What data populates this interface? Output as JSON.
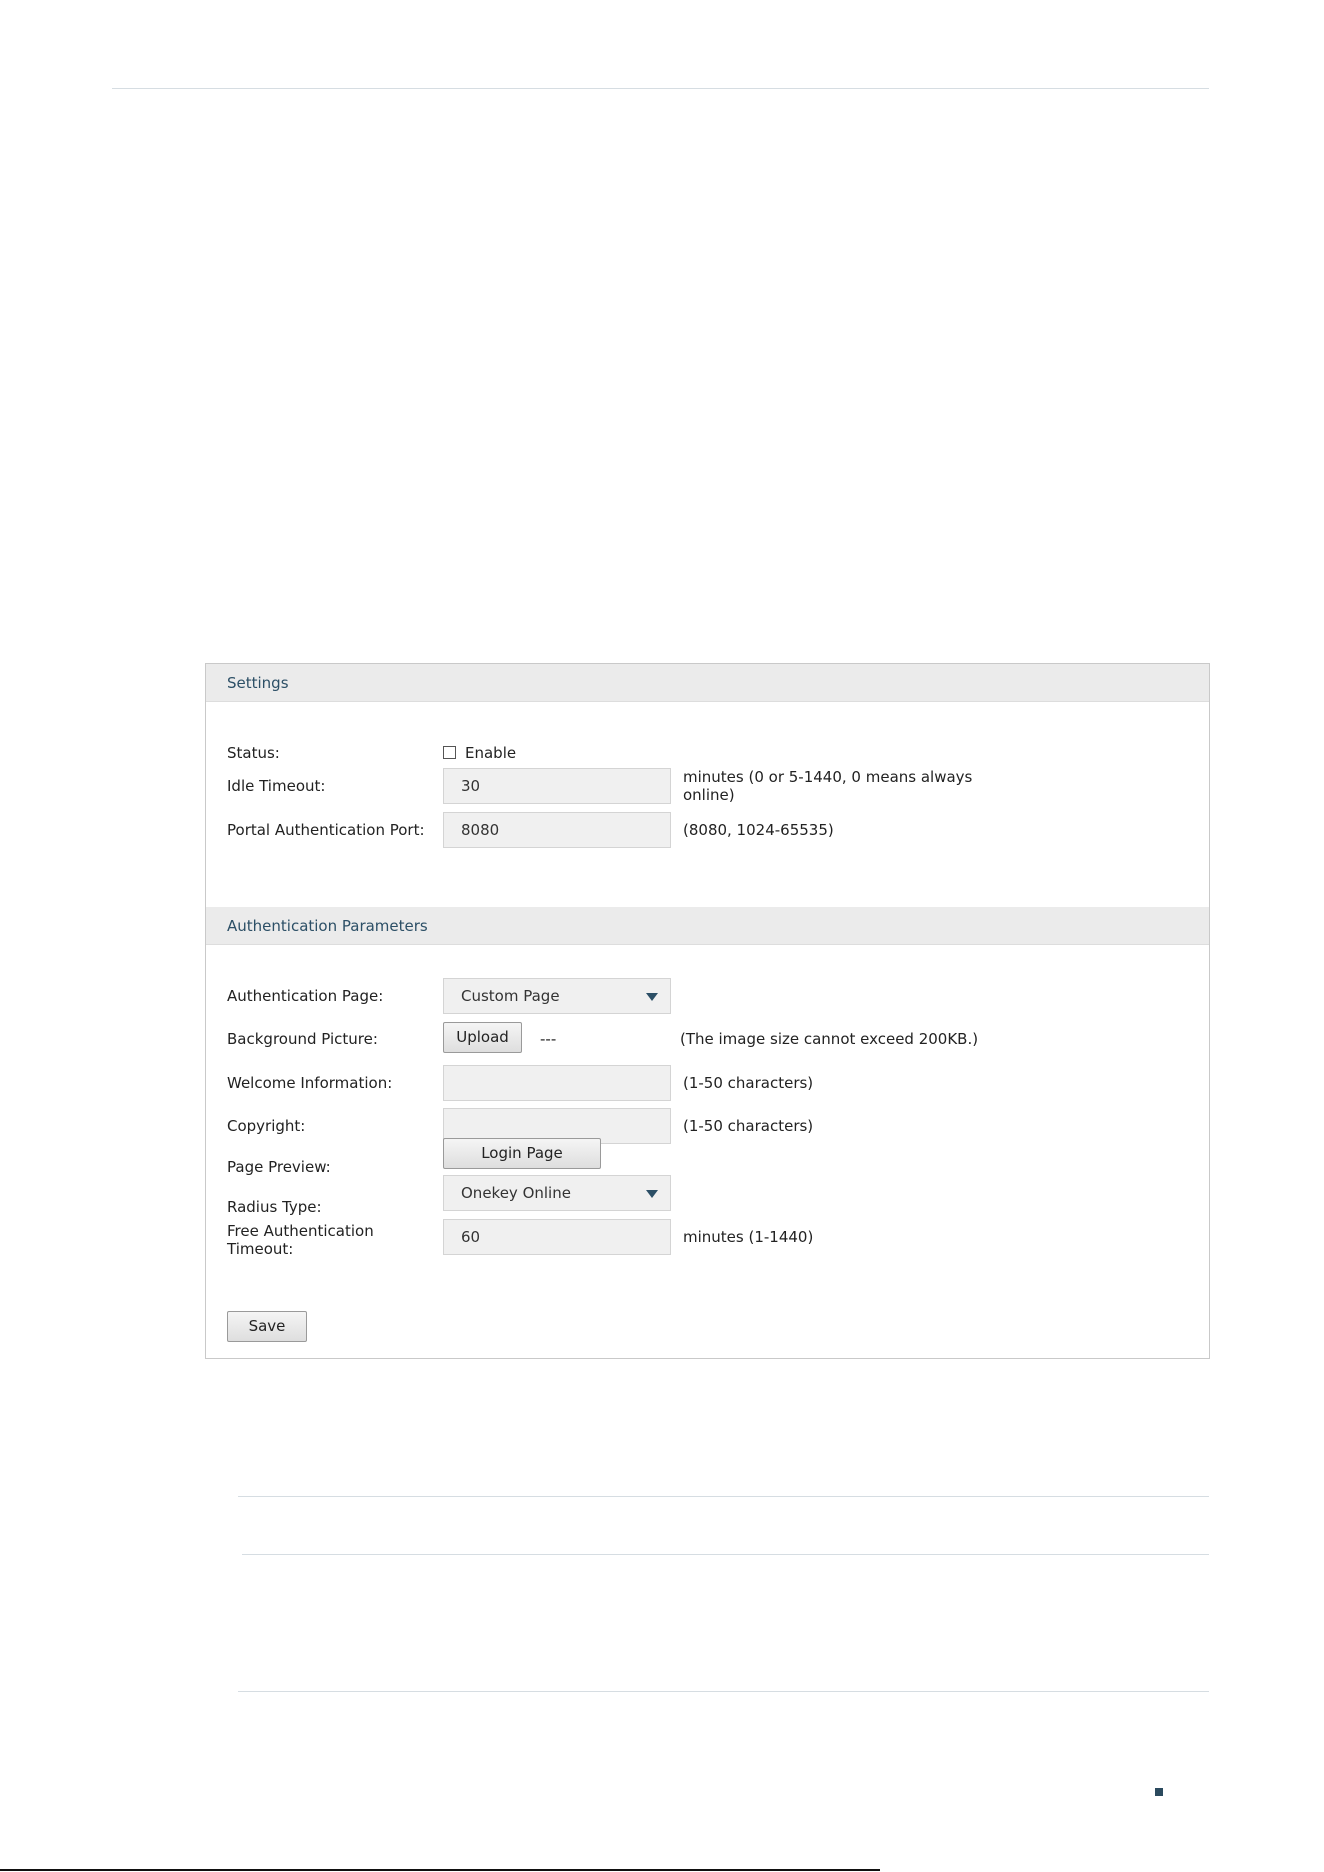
{
  "settings": {
    "header": "Settings",
    "status_label": "Status:",
    "status_option": "Enable",
    "status_checked": false,
    "idle_timeout_label": "Idle Timeout:",
    "idle_timeout_value": "30",
    "idle_timeout_hint_line1": "minutes (0 or 5-1440, 0 means always",
    "idle_timeout_hint_line2": "online)",
    "port_label": "Portal Authentication Port:",
    "port_value": "8080",
    "port_hint": "(8080, 1024-65535)"
  },
  "auth_params": {
    "header": "Authentication Parameters",
    "auth_page_label": "Authentication Page:",
    "auth_page_value": "Custom Page",
    "bg_picture_label": "Background Picture:",
    "upload_button": "Upload",
    "bg_picture_file": "---",
    "bg_picture_hint": "(The image size cannot exceed 200KB.)",
    "welcome_label": "Welcome Information:",
    "welcome_value": "",
    "welcome_hint": "(1-50 characters)",
    "copyright_label": "Copyright:",
    "copyright_value": "",
    "copyright_hint": "(1-50 characters)",
    "preview_label": "Page Preview:",
    "preview_button": "Login Page Preview",
    "radius_label": "Radius Type:",
    "radius_value": "Onekey Online",
    "free_auth_label_line1": "Free Authentication",
    "free_auth_label_line2": "Timeout:",
    "free_auth_value": "60",
    "free_auth_hint": "minutes (1-1440)"
  },
  "save_button": "Save",
  "icons": {
    "dropdown": "caret-down-icon",
    "page_marker": "square-marker-icon"
  },
  "colors": {
    "header_bg": "#ebebeb",
    "header_text": "#2c4f66",
    "field_bg": "#f0f0f0",
    "caret": "#2c4f66"
  }
}
